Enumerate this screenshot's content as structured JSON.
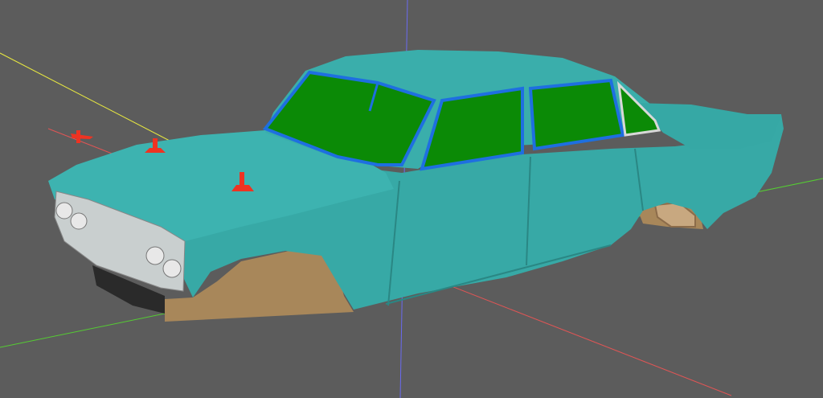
{
  "viewport": {
    "background": "#5c5c5c",
    "axes": {
      "x_color": "#e05555",
      "y_color": "#55cc33",
      "z_color": "#5555e8",
      "extra_color": "#e8e840"
    },
    "model": {
      "name": "car-body",
      "body_color": "#37a9a6",
      "body_shadow_color": "#2a8784",
      "glass_color": "#0b8a06",
      "window_frame_color": "#1e6fe0",
      "chrome_color": "#d8d8d8",
      "underside_color": "#a8875a"
    },
    "markers": {
      "color": "#ee3322",
      "count": 3
    }
  }
}
